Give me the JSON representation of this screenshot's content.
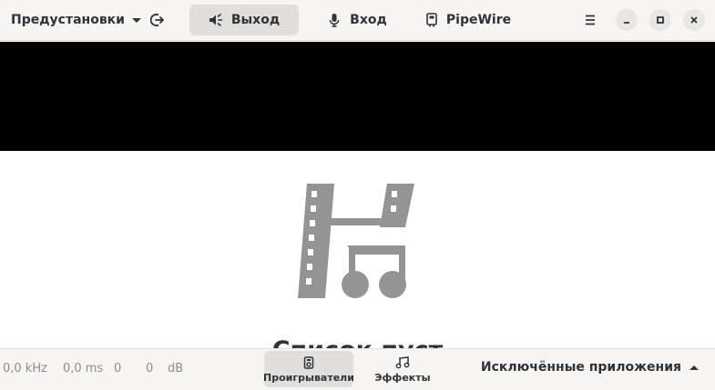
{
  "header": {
    "presets_label": "Предустановки",
    "tabs": [
      {
        "label": "Выход",
        "icon": "speaker-icon",
        "active": true
      },
      {
        "label": "Вход",
        "icon": "microphone-icon",
        "active": false
      },
      {
        "label": "PipeWire",
        "icon": "device-icon",
        "active": false
      }
    ],
    "icons": {
      "bypass": "bypass-icon",
      "menu": "hamburger-menu-icon",
      "minimize": "minimize-icon",
      "maximize": "maximize-icon",
      "close": "close-icon"
    }
  },
  "empty_state": {
    "icon": "video-audio-icon",
    "title": "Список пуст"
  },
  "bottombar": {
    "rate": "0,0 kHz",
    "latency": "0,0 ms",
    "value_a": "0",
    "value_b": "0",
    "db": "dB",
    "views": [
      {
        "label": "Проигрыватели",
        "icon": "player-icon",
        "active": true
      },
      {
        "label": "Эффекты",
        "icon": "music-notes-icon",
        "active": false
      }
    ],
    "excluded_label": "Исключённые приложения"
  },
  "colors": {
    "header_bg": "#f6f5f4",
    "active_bg": "#e0dfde",
    "text": "#2e3436",
    "muted_text": "#8b8e8f",
    "icon_gray": "#949494",
    "band": "#000000"
  }
}
